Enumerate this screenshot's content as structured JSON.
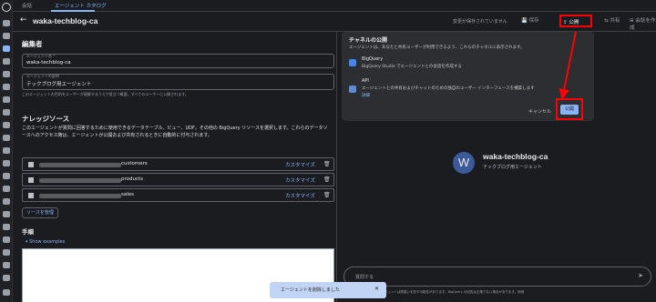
{
  "tabs": [
    {
      "label": "会話"
    },
    {
      "label": "エージェント カタログ"
    }
  ],
  "header": {
    "back": "←",
    "title": "waka-techblog-ca",
    "unsaved": "変更が保存されていません",
    "save": "保存",
    "publish": "公開",
    "share": "共有",
    "create_publish": "会話を作成"
  },
  "editor": {
    "title": "編集者",
    "name_label": "エージェント名 *",
    "name_value": "waka-techblog-ca",
    "desc_label": "エージェントの説明",
    "desc_value": "テックブログ用エージェント",
    "desc_hint": "このエージェントの目的をユーザーが理解するうえで役立つ概要。すべてのユーザーに公開されます。"
  },
  "knowledge": {
    "title": "ナレッジソース",
    "description": "このエージェントが質問に回答するために使用できるデータテーブル、ビュー、UDF。その他の BigQuery リソースを選択します。これらのデータソースへのアクセス権は、エージェントが公開および共有されるときに自動的に付与されます。",
    "sources": [
      {
        "name": "customers",
        "customize": "カスタマイズ"
      },
      {
        "name": "products",
        "customize": "カスタマイズ"
      },
      {
        "name": "sales",
        "customize": "カスタマイズ"
      }
    ],
    "manage": "ソースを管理"
  },
  "instructions": {
    "title": "手順",
    "show_examples": "Show examples"
  },
  "publish_popup": {
    "title": "チャネルの公開",
    "subtitle": "エージェントは、あなたと共有ユーザーが利用できるよう、これらのチャネルに表示されます。",
    "channels": [
      {
        "name": "BigQuery",
        "desc": "BigQuery Studio でエージェントとの会話を作成する"
      },
      {
        "name": "API",
        "desc": "エージェントとの共有およびチャットのための独自のユーザー インターフェースを構築します",
        "link": "詳細"
      }
    ],
    "cancel": "キャンセル",
    "publish": "公開"
  },
  "preview": {
    "avatar_letter": "W",
    "name": "waka-techblog-ca",
    "desc": "テックブログ用エージェント",
    "input_placeholder": "質問する",
    "disclaimer": "このエージェントは間違いを犯す可能性があります。BigQuery の回答は正確でない場合があります。詳細"
  },
  "toast": {
    "message": "エージェントを削除しました",
    "close": "✕"
  },
  "colors": {
    "accent": "#8ab4f8",
    "highlight": "#ff0000",
    "background": "#1b1c1f"
  }
}
